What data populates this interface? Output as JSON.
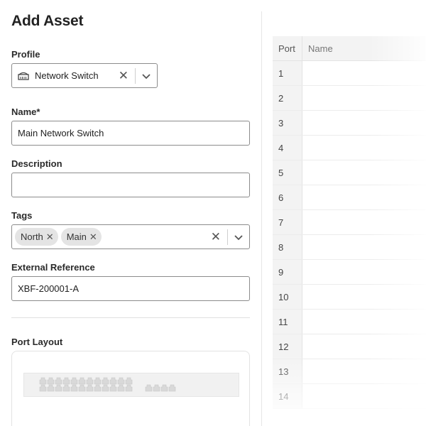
{
  "form": {
    "title": "Add Asset",
    "profile": {
      "label": "Profile",
      "value": "Network Switch",
      "icon": "network-switch-icon"
    },
    "name": {
      "label": "Name*",
      "value": "Main Network Switch"
    },
    "description": {
      "label": "Description",
      "value": ""
    },
    "tags": {
      "label": "Tags",
      "items": [
        "North",
        "Main"
      ]
    },
    "external_reference": {
      "label": "External Reference",
      "value": "XBF-200001-A"
    },
    "port_layout": {
      "label": "Port Layout"
    }
  },
  "ports_table": {
    "headers": {
      "port": "Port",
      "name": "Name"
    },
    "rows": [
      "1",
      "2",
      "3",
      "4",
      "5",
      "6",
      "7",
      "8",
      "9",
      "10",
      "11",
      "12",
      "13",
      "14"
    ]
  }
}
